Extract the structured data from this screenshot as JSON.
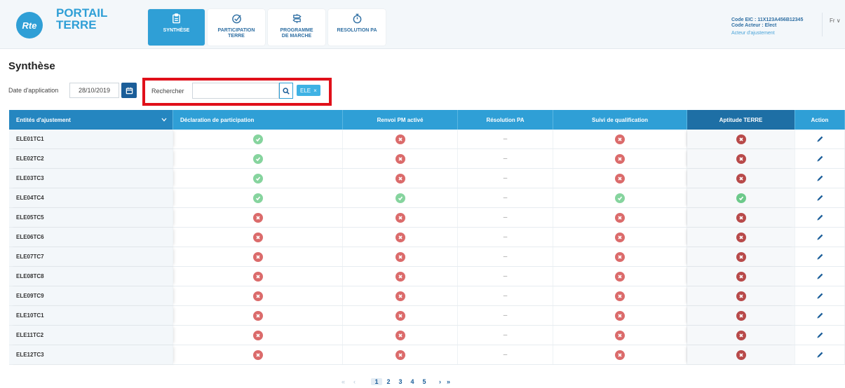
{
  "header": {
    "logo_text": "Rte",
    "brand_line1": "PORTAIL",
    "brand_line2": "TERRE",
    "nav": [
      {
        "label": "SYNTHÈSE",
        "icon": "clipboard-icon",
        "active": true
      },
      {
        "label": "PARTICIPATION\nTERRE",
        "icon": "check-circle-icon",
        "active": false
      },
      {
        "label": "PROGRAMME\nDE MARCHE",
        "icon": "signpost-icon",
        "active": false
      },
      {
        "label": "RESOLUTION PA",
        "icon": "stopwatch-icon",
        "active": false
      }
    ],
    "user": {
      "code_eic": "Code EIC : 11X123A456B12345",
      "code_acteur": "Code Acteur : Elect",
      "role": "Acteur d'ajustement"
    },
    "lang": "Fr ∨"
  },
  "page": {
    "title": "Synthèse"
  },
  "filters": {
    "date_label": "Date d'application",
    "date_value": "28/10/2019",
    "search_label": "Rechercher",
    "search_value": "",
    "chip_label": "ELE",
    "chip_close": "×"
  },
  "table": {
    "columns": [
      "Entités d'ajustement",
      "Déclaration de participation",
      "Renvoi PM activé",
      "Résolution PA",
      "Suivi de qualification",
      "Aptitude TERRE",
      "Action"
    ],
    "rows": [
      {
        "name": "ELE01TC1",
        "decl": "ok",
        "renvoi": "ko",
        "resolution": "–",
        "suivi": "ko",
        "aptitude": "ko"
      },
      {
        "name": "ELE02TC2",
        "decl": "ok",
        "renvoi": "ko",
        "resolution": "–",
        "suivi": "ko",
        "aptitude": "ko"
      },
      {
        "name": "ELE03TC3",
        "decl": "ok",
        "renvoi": "ko",
        "resolution": "–",
        "suivi": "ko",
        "aptitude": "ko"
      },
      {
        "name": "ELE04TC4",
        "decl": "ok",
        "renvoi": "ok",
        "resolution": "–",
        "suivi": "ok",
        "aptitude": "ok"
      },
      {
        "name": "ELE05TC5",
        "decl": "ko",
        "renvoi": "ko",
        "resolution": "–",
        "suivi": "ko",
        "aptitude": "ko"
      },
      {
        "name": "ELE06TC6",
        "decl": "ko",
        "renvoi": "ko",
        "resolution": "–",
        "suivi": "ko",
        "aptitude": "ko"
      },
      {
        "name": "ELE07TC7",
        "decl": "ko",
        "renvoi": "ko",
        "resolution": "–",
        "suivi": "ko",
        "aptitude": "ko"
      },
      {
        "name": "ELE08TC8",
        "decl": "ko",
        "renvoi": "ko",
        "resolution": "–",
        "suivi": "ko",
        "aptitude": "ko"
      },
      {
        "name": "ELE09TC9",
        "decl": "ko",
        "renvoi": "ko",
        "resolution": "–",
        "suivi": "ko",
        "aptitude": "ko"
      },
      {
        "name": "ELE10TC1",
        "decl": "ko",
        "renvoi": "ko",
        "resolution": "–",
        "suivi": "ko",
        "aptitude": "ko"
      },
      {
        "name": "ELE11TC2",
        "decl": "ko",
        "renvoi": "ko",
        "resolution": "–",
        "suivi": "ko",
        "aptitude": "ko"
      },
      {
        "name": "ELE12TC3",
        "decl": "ko",
        "renvoi": "ko",
        "resolution": "–",
        "suivi": "ko",
        "aptitude": "ko"
      }
    ]
  },
  "pagination": {
    "first": "«",
    "prev": "‹",
    "pages": [
      "1",
      "2",
      "3",
      "4",
      "5"
    ],
    "current": "1",
    "next": "›",
    "last": "»"
  },
  "colors": {
    "primary": "#2f9fd6",
    "dark_blue": "#1b5e99",
    "ok": "#6cc98a",
    "ko": "#db6b6b",
    "highlight": "#e0101a"
  }
}
